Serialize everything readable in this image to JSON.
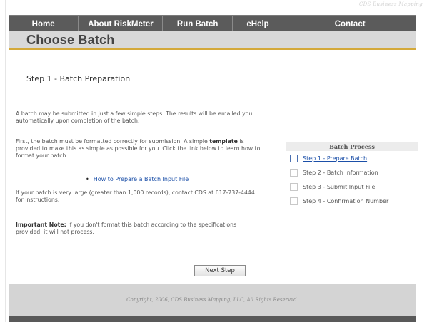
{
  "brand": "CDS Business Mapping",
  "nav": {
    "items": [
      "Home",
      "About RiskMeter",
      "Run Batch",
      "eHelp",
      "Contact"
    ]
  },
  "page_title": "Choose Batch",
  "step_heading": "Step 1 - Batch Preparation",
  "paragraphs": {
    "p1": "A batch may be submitted in just a few simple steps. The results will be emailed you automatically upon completion of the batch.",
    "p2_before": "First, the batch must be formatted correctly for submission. A simple ",
    "p2_bold": "template",
    "p2_after": " is provided to make this as simple as possible for you. Click the link below to learn how to format your batch.",
    "link": "How to Prepare a Batch Input File",
    "p3": "If your batch is very large (greater than 1,000 records), contact CDS at 617-737-4444 for instructions.",
    "p4_bold": "Important Note:",
    "p4_after": " If you don't format this batch according to the specifications provided, it will not process."
  },
  "next_button": "Next Step",
  "panel": {
    "title": "Batch Process",
    "items": [
      {
        "label": "Step 1 - Prepare Batch",
        "active": true
      },
      {
        "label": "Step 2 - Batch Information",
        "active": false
      },
      {
        "label": "Step 3 - Submit Input File",
        "active": false
      },
      {
        "label": "Step 4 - Confirmation Number",
        "active": false
      }
    ]
  },
  "footer": "Copyright, 2006, CDS Business Mapping, LLC, All Rights Reserved."
}
